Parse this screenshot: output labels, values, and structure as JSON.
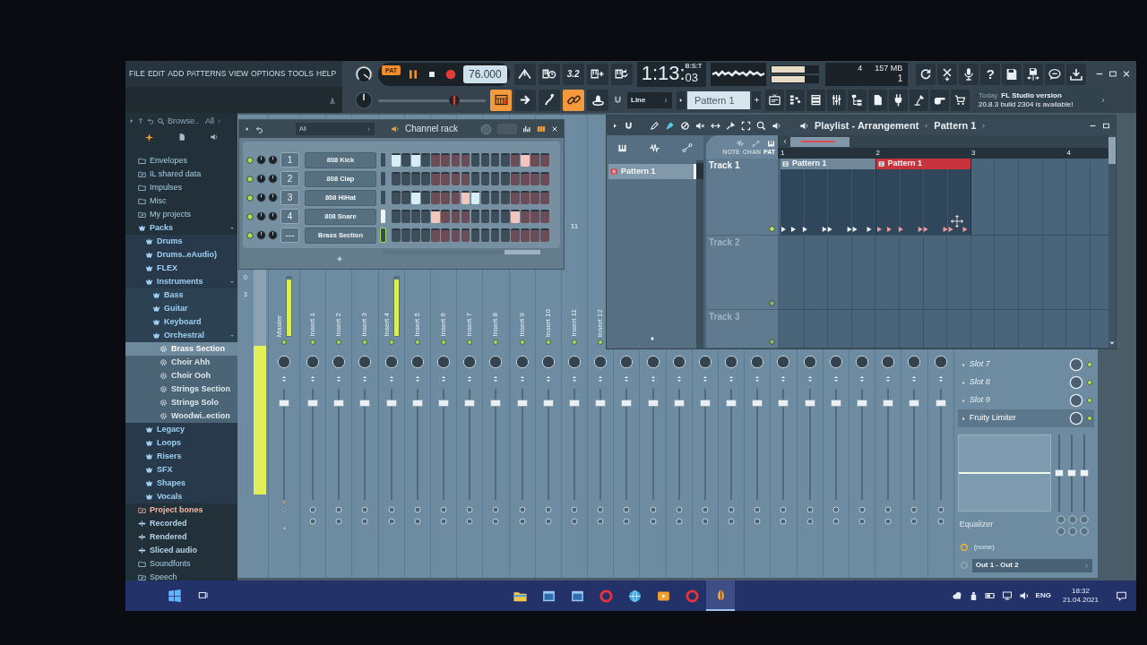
{
  "menu": [
    "FILE",
    "EDIT",
    "ADD",
    "PATTERNS",
    "VIEW",
    "OPTIONS",
    "TOOLS",
    "HELP"
  ],
  "transport": {
    "mode": "PAT",
    "tempo": "76.000"
  },
  "record_buttons": [
    {
      "kind": "metronome",
      "on": false
    },
    {
      "kind": "wait",
      "on": false
    },
    {
      "kind": "countdown",
      "label": "3.2",
      "on": false
    },
    {
      "kind": "overdub",
      "on": false
    },
    {
      "kind": "loop-record",
      "on": false
    }
  ],
  "time": {
    "value": "1:13:",
    "fraction": "03",
    "format": "B:S:T"
  },
  "cpu_meters": [
    {
      "level": 0.7
    },
    {
      "level": 0.7
    }
  ],
  "monitor": {
    "readouts": [
      "4",
      "157 MB",
      "1"
    ]
  },
  "help_button": "?",
  "master_pitch": {
    "level": 0.74
  },
  "modes": [
    {
      "kind": "keyboard",
      "on": true
    },
    {
      "kind": "arrow",
      "on": false
    },
    {
      "kind": "curve",
      "on": false
    },
    {
      "kind": "link",
      "on": true
    },
    {
      "kind": "bell",
      "on": false
    }
  ],
  "snap": {
    "value": "Line"
  },
  "pattern_selector": {
    "value": "Pattern 1"
  },
  "news": {
    "lead": "Today",
    "title": "FL Studio version",
    "body": "20.8.3 build 2304 is available!"
  },
  "browser": {
    "title": "Browse..",
    "filter": "All",
    "items": [
      {
        "name": "Envelopes",
        "kind": "folder",
        "selected": false
      },
      {
        "name": "IL shared data",
        "kind": "link",
        "selected": false
      },
      {
        "name": "Impulses",
        "kind": "folder",
        "selected": false
      },
      {
        "name": "Misc",
        "kind": "folder",
        "selected": false
      },
      {
        "name": "My projects",
        "kind": "link",
        "selected": false
      },
      {
        "name": "Packs",
        "kind": "pack",
        "selected": false,
        "children": [
          {
            "name": "Drums",
            "kind": "pack",
            "selected": false
          },
          {
            "name": "Drums..eAudio)",
            "kind": "pack",
            "selected": false
          },
          {
            "name": "FLEX",
            "kind": "pack",
            "selected": false
          },
          {
            "name": "Instruments",
            "kind": "pack",
            "selected": false,
            "children": [
              {
                "name": "Bass",
                "kind": "pack",
                "selected": false
              },
              {
                "name": "Guitar",
                "kind": "pack",
                "selected": false
              },
              {
                "name": "Keyboard",
                "kind": "pack",
                "selected": false
              },
              {
                "name": "Orchestral",
                "kind": "pack",
                "selected": false,
                "children": [
                  {
                    "name": "Brass Section",
                    "kind": "preset",
                    "selected": true
                  },
                  {
                    "name": "Choir Ahh",
                    "kind": "preset",
                    "selected": false
                  },
                  {
                    "name": "Choir Ooh",
                    "kind": "preset",
                    "selected": false
                  },
                  {
                    "name": "Strings Section",
                    "kind": "preset",
                    "selected": false
                  },
                  {
                    "name": "Strings Solo",
                    "kind": "preset",
                    "selected": false
                  },
                  {
                    "name": "Woodwi..ection",
                    "kind": "preset",
                    "selected": false
                  }
                ]
              }
            ]
          },
          {
            "name": "Legacy",
            "kind": "pack",
            "selected": false
          },
          {
            "name": "Loops",
            "kind": "pack",
            "selected": false
          },
          {
            "name": "Risers",
            "kind": "pack",
            "selected": false
          },
          {
            "name": "SFX",
            "kind": "pack",
            "selected": false
          },
          {
            "name": "Shapes",
            "kind": "pack",
            "selected": false
          },
          {
            "name": "Vocals",
            "kind": "pack",
            "selected": false
          }
        ]
      },
      {
        "name": "Project bones",
        "kind": "project",
        "selected": false
      },
      {
        "name": "Recorded",
        "kind": "audio",
        "selected": false
      },
      {
        "name": "Rendered",
        "kind": "audio",
        "selected": false
      },
      {
        "name": "Sliced audio",
        "kind": "audio",
        "selected": false
      },
      {
        "name": "Soundfonts",
        "kind": "folder",
        "selected": false
      },
      {
        "name": "Speech",
        "kind": "link",
        "selected": false
      }
    ]
  },
  "channel_rack": {
    "title": "Channel rack",
    "filter": "All",
    "channels": [
      {
        "number": "1",
        "name": "808 Kick",
        "enabled": true,
        "selected": false,
        "focused": false,
        "steps": [
          true,
          false,
          true,
          false,
          false,
          false,
          false,
          false,
          false,
          false,
          false,
          false,
          false,
          true,
          false,
          false
        ]
      },
      {
        "number": "2",
        "name": "808 Clap",
        "enabled": true,
        "selected": false,
        "focused": false,
        "steps": [
          false,
          false,
          false,
          false,
          false,
          false,
          false,
          false,
          false,
          false,
          false,
          false,
          false,
          false,
          false,
          false
        ]
      },
      {
        "number": "3",
        "name": "808 HiHat",
        "enabled": true,
        "selected": false,
        "focused": false,
        "steps": [
          false,
          false,
          true,
          false,
          false,
          false,
          false,
          true,
          true,
          false,
          false,
          false,
          false,
          false,
          false,
          false
        ]
      },
      {
        "number": "4",
        "name": "808 Snare",
        "enabled": true,
        "selected": true,
        "focused": false,
        "steps": [
          false,
          false,
          false,
          false,
          true,
          false,
          false,
          false,
          false,
          false,
          false,
          false,
          true,
          false,
          false,
          false
        ]
      },
      {
        "number": "---",
        "name": "Brass Section",
        "enabled": true,
        "selected": false,
        "focused": true,
        "steps": [
          false,
          false,
          false,
          false,
          false,
          false,
          false,
          false,
          false,
          false,
          false,
          false,
          false,
          false,
          false,
          false
        ]
      }
    ]
  },
  "mixer": {
    "scale": [
      "0",
      "3"
    ],
    "peak": {
      "level": 0.66
    },
    "master": {
      "label": "Master",
      "meter": {
        "level": 0.95
      },
      "fader": {
        "level": 0.9
      }
    },
    "inserts": [
      {
        "label": "Insert 1",
        "fader": {
          "level": 0.9
        }
      },
      {
        "label": "Insert 2",
        "fader": {
          "level": 0.9
        }
      },
      {
        "label": "Insert 3",
        "fader": {
          "level": 0.9
        }
      },
      {
        "label": "Insert 4",
        "meter": {
          "level": 0.95
        },
        "fader": {
          "level": 0.9
        }
      },
      {
        "label": "Insert 5",
        "fader": {
          "level": 0.9
        }
      },
      {
        "label": "Insert 6",
        "fader": {
          "level": 0.9
        }
      },
      {
        "label": "Insert 7",
        "fader": {
          "level": 0.9
        }
      },
      {
        "label": "Insert 8",
        "fader": {
          "level": 0.9
        }
      },
      {
        "label": "Insert 9",
        "fader": {
          "level": 0.9
        }
      },
      {
        "label": "Insert 10",
        "fader": {
          "level": 0.9
        }
      },
      {
        "label": "Insert 11",
        "number": "11",
        "fader": {
          "level": 0.9
        }
      },
      {
        "label": "Insert 12",
        "fader": {
          "level": 0.9
        }
      },
      {
        "fader": {
          "level": 0.9
        }
      },
      {
        "fader": {
          "level": 0.9
        }
      },
      {
        "fader": {
          "level": 0.9
        }
      },
      {
        "fader": {
          "level": 0.9
        }
      },
      {
        "fader": {
          "level": 0.9
        }
      },
      {
        "fader": {
          "level": 0.9
        }
      },
      {
        "fader": {
          "level": 0.9
        }
      },
      {
        "fader": {
          "level": 0.9
        }
      },
      {
        "fader": {
          "level": 0.9
        }
      },
      {
        "fader": {
          "level": 0.9
        }
      },
      {
        "fader": {
          "level": 0.9
        }
      },
      {
        "fader": {
          "level": 0.9
        }
      },
      {
        "fader": {
          "level": 0.9
        }
      }
    ],
    "slots": [
      {
        "name": "Slot 7",
        "empty": true
      },
      {
        "name": "Slot 8",
        "empty": true
      },
      {
        "name": "Slot 9",
        "empty": true
      },
      {
        "name": "Fruity Limiter",
        "empty": false
      }
    ],
    "eq": {
      "label": "Equalizer",
      "bands": [
        {
          "level": 0.5
        },
        {
          "level": 0.5
        },
        {
          "level": 0.5
        }
      ]
    },
    "input": "(none)",
    "output": "Out 1 - Out 2"
  },
  "playlist": {
    "tools": [
      {
        "kind": "draw",
        "selected": false
      },
      {
        "kind": "paint",
        "selected": true
      },
      {
        "kind": "delete",
        "selected": false
      },
      {
        "kind": "mute",
        "selected": false
      },
      {
        "kind": "slip",
        "selected": false
      },
      {
        "kind": "slice",
        "selected": false
      },
      {
        "kind": "select",
        "selected": false
      },
      {
        "kind": "zoom",
        "selected": false
      },
      {
        "kind": "playback",
        "selected": false
      }
    ],
    "title": "Playlist - Arrangement",
    "current_pattern": "Pattern 1",
    "patterns": [
      {
        "name": "Pattern 1",
        "selected": true
      }
    ],
    "filters": [
      {
        "label": "NOTE",
        "selected": false
      },
      {
        "label": "CHAN",
        "selected": false
      },
      {
        "label": "PAT",
        "selected": true
      }
    ],
    "ruler": [
      "1",
      "2",
      "3",
      "4"
    ],
    "tracks": [
      {
        "name": "Track 1",
        "clips": [
          {
            "name": "Pattern 1",
            "selected": false
          },
          {
            "name": "Pattern 1",
            "selected": true
          }
        ]
      },
      {
        "name": "Track 2"
      },
      {
        "name": "Track 3"
      }
    ]
  },
  "taskbar": {
    "apps": [
      {
        "kind": "folder",
        "active": false
      },
      {
        "kind": "window",
        "active": false
      },
      {
        "kind": "window",
        "active": false
      },
      {
        "kind": "ring",
        "active": false
      },
      {
        "kind": "globe",
        "active": false
      },
      {
        "kind": "media",
        "active": false
      },
      {
        "kind": "ring",
        "active": false
      },
      {
        "kind": "fruit",
        "active": true
      }
    ],
    "language": "ENG",
    "time": "18:32",
    "date": "21.04.2021"
  }
}
